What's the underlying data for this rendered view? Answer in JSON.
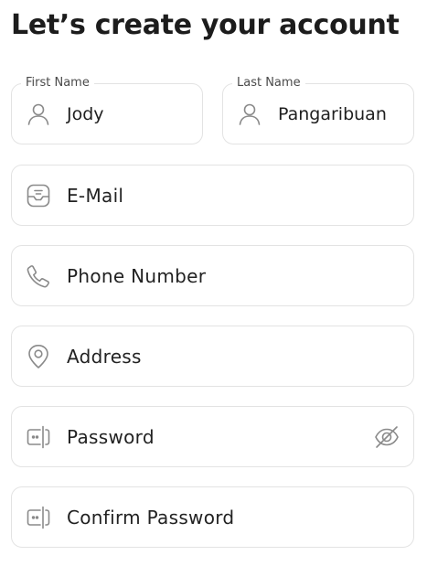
{
  "title": "Let’s create your account",
  "first_name": {
    "label": "First Name",
    "value": "Jody",
    "icon": "user-icon"
  },
  "last_name": {
    "label": "Last Name",
    "value": "Pangaribuan",
    "icon": "user-icon"
  },
  "email": {
    "placeholder": "E-Mail",
    "icon": "mail-icon"
  },
  "phone": {
    "placeholder": "Phone Number",
    "icon": "phone-icon"
  },
  "address": {
    "placeholder": "Address",
    "icon": "location-pin-icon"
  },
  "password": {
    "placeholder": "Password",
    "icon": "password-icon",
    "toggle_icon": "eye-off-icon"
  },
  "confirm_password": {
    "placeholder": "Confirm Password",
    "icon": "password-icon"
  },
  "colors": {
    "border": "#e3e3e3",
    "icon": "#8a8a8a",
    "text": "#1f1f1f"
  }
}
